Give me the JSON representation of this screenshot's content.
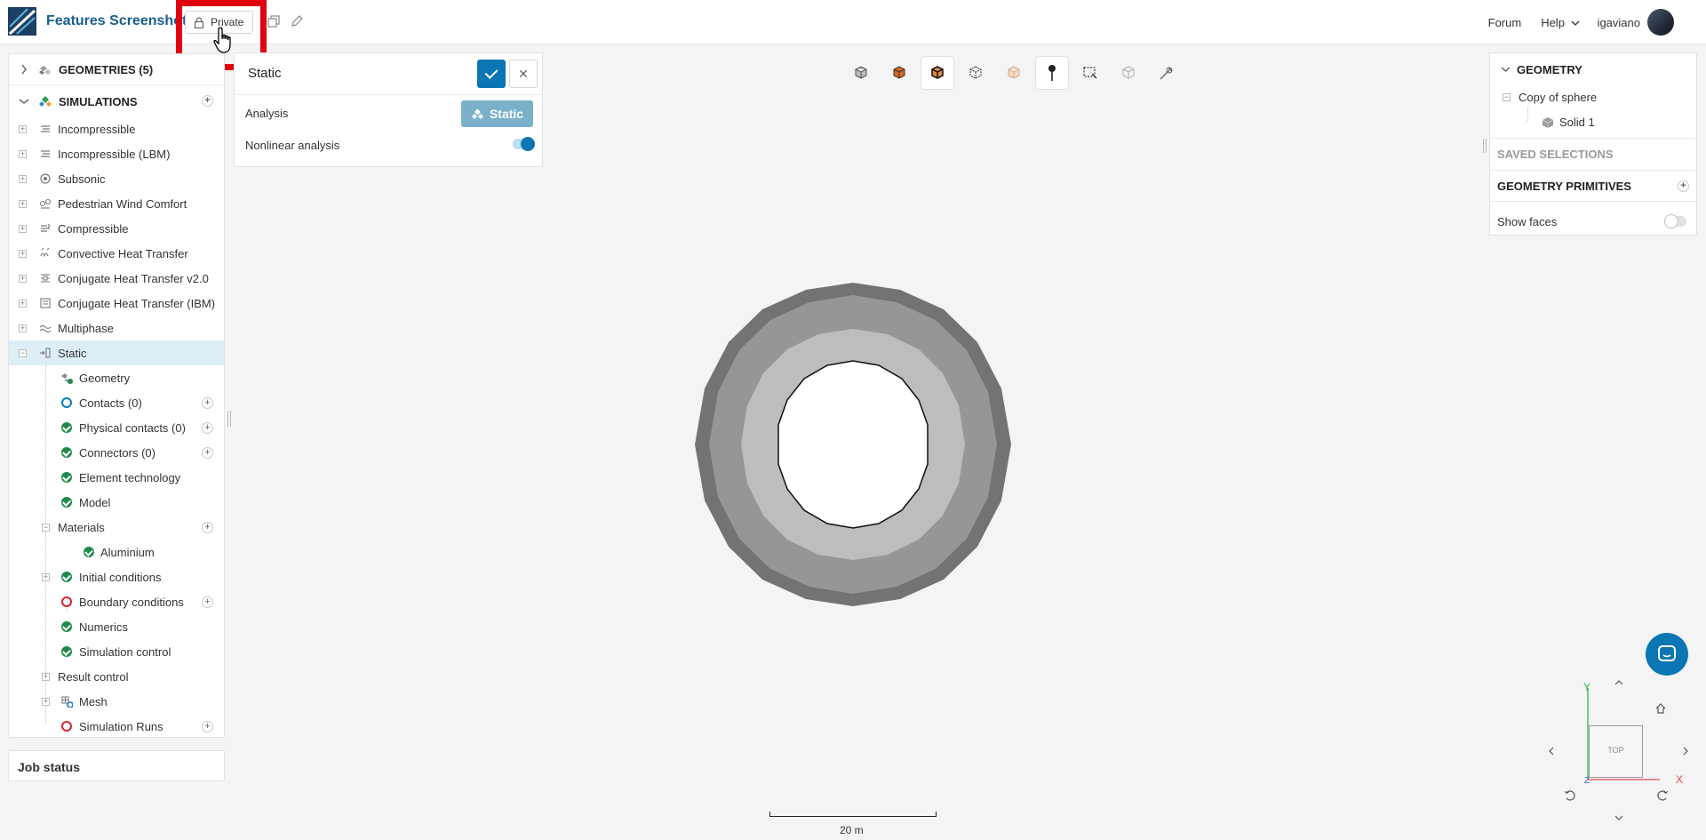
{
  "header": {
    "project_title": "Features Screenshot",
    "private_label": "Private",
    "forum_label": "Forum",
    "help_label": "Help",
    "username": "igaviano"
  },
  "tree": {
    "geometries_label": "GEOMETRIES (5)",
    "simulations_label": "SIMULATIONS",
    "simulation_types": [
      {
        "label": "Incompressible",
        "icon": "incompressible-icon"
      },
      {
        "label": "Incompressible (LBM)",
        "icon": "incompressible-lbm-icon"
      },
      {
        "label": "Subsonic",
        "icon": "subsonic-icon"
      },
      {
        "label": "Pedestrian Wind Comfort",
        "icon": "wind-comfort-icon"
      },
      {
        "label": "Compressible",
        "icon": "compressible-icon"
      },
      {
        "label": "Convective Heat Transfer",
        "icon": "heat-transfer-icon"
      },
      {
        "label": "Conjugate Heat Transfer v2.0",
        "icon": "cht-icon"
      },
      {
        "label": "Conjugate Heat Transfer (IBM)",
        "icon": "cht-ibm-icon"
      },
      {
        "label": "Multiphase",
        "icon": "multiphase-icon"
      },
      {
        "label": "Static",
        "icon": "static-icon"
      }
    ],
    "static_children": [
      {
        "label": "Geometry",
        "status": "geometry"
      },
      {
        "label": "Contacts (0)",
        "status": "blue"
      },
      {
        "label": "Physical contacts (0)",
        "status": "ok"
      },
      {
        "label": "Connectors (0)",
        "status": "ok"
      },
      {
        "label": "Element technology",
        "status": "ok"
      },
      {
        "label": "Model",
        "status": "ok"
      },
      {
        "label": "Materials",
        "status": "none"
      },
      {
        "label": "Aluminium",
        "status": "ok"
      },
      {
        "label": "Initial conditions",
        "status": "ok"
      },
      {
        "label": "Boundary conditions",
        "status": "red"
      },
      {
        "label": "Numerics",
        "status": "ok"
      },
      {
        "label": "Simulation control",
        "status": "ok"
      },
      {
        "label": "Result control",
        "status": "none"
      },
      {
        "label": "Mesh",
        "status": "mesh"
      },
      {
        "label": "Simulation Runs",
        "status": "red"
      }
    ]
  },
  "job_status_label": "Job status",
  "static_panel": {
    "title": "Static",
    "analysis_label": "Analysis",
    "analysis_value": "Static",
    "nonlinear_label": "Nonlinear analysis",
    "nonlinear_enabled": true
  },
  "right_panel": {
    "geometry_label": "GEOMETRY",
    "geometry_item": "Copy of sphere",
    "solid_item": "Solid 1",
    "saved_selections_label": "SAVED SELECTIONS",
    "primitives_label": "GEOMETRY PRIMITIVES",
    "show_faces_label": "Show faces",
    "show_faces_enabled": false
  },
  "viewport": {
    "scale_label": "20 m",
    "orientation_label": "TOP",
    "axis_x": "X",
    "axis_y": "Y",
    "axis_z": "Z"
  },
  "colors": {
    "accent": "#0a76b4",
    "ok": "#1f8a4c",
    "error": "#d6262c",
    "highlight": "#e0000f"
  }
}
